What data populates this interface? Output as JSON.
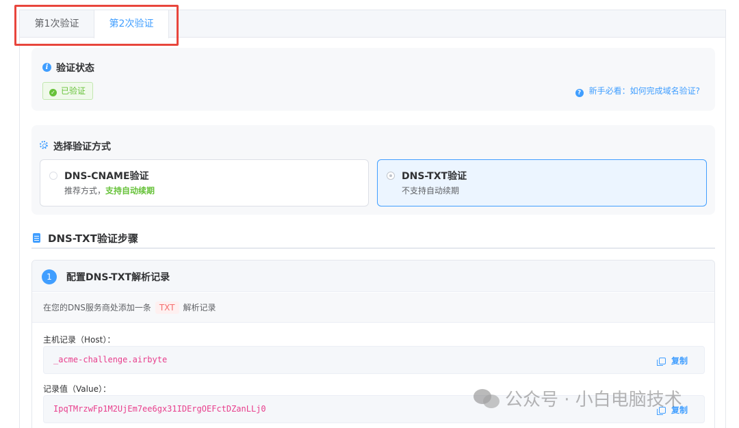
{
  "tabs": [
    {
      "label": "第1次验证",
      "active": false
    },
    {
      "label": "第2次验证",
      "active": true
    }
  ],
  "status": {
    "title": "验证状态",
    "badge": "已验证",
    "help_link": "新手必看：如何完成域名验证?"
  },
  "method": {
    "title": "选择验证方式",
    "options": [
      {
        "name": "DNS-CNAME验证",
        "desc_prefix": "推荐方式，",
        "desc_highlight": "支持自动续期",
        "selected": false
      },
      {
        "name": "DNS-TXT验证",
        "desc_prefix": "不支持自动续期",
        "desc_highlight": "",
        "selected": true
      }
    ]
  },
  "steps": {
    "title": "DNS-TXT验证步骤",
    "step1": {
      "number": "1",
      "title": "配置DNS-TXT解析记录",
      "desc_before": "在您的DNS服务商处添加一条",
      "desc_tag": "TXT",
      "desc_after": "解析记录",
      "host_label": "主机记录（Host）：",
      "host_value": "_acme-challenge.airbyte",
      "value_label": "记录值（Value）：",
      "value_value": "IpqTMrzwFp1M2UjEm7ee6gx31IDErgOEFctDZanLLj0",
      "copy_label": "复制"
    }
  },
  "watermark": "公众号 · 小白电脑技术",
  "colors": {
    "primary": "#409eff",
    "success": "#67c23a",
    "danger": "#f56c6c",
    "highlight_border": "#e8453c"
  }
}
